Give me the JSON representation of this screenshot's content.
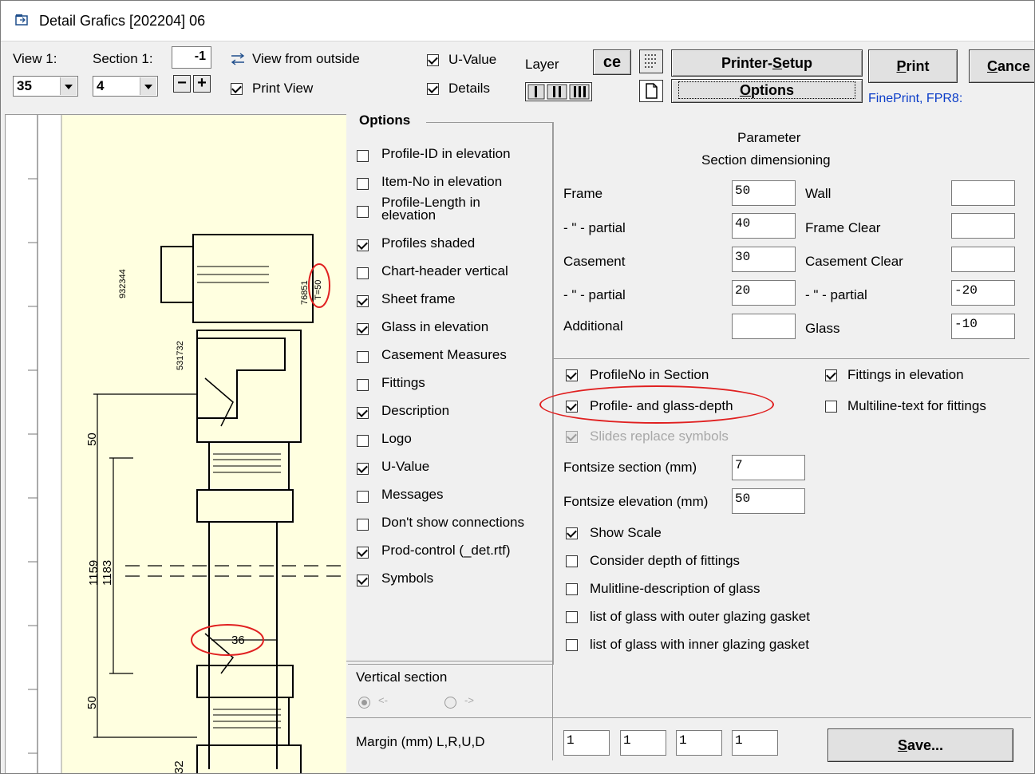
{
  "window": {
    "title": "Detail Grafics [202204] 06"
  },
  "toolbar": {
    "view_label": "View 1:",
    "view_value": "35",
    "section_label": "Section 1:",
    "section_value": "4",
    "section_offset": "-1",
    "view_from_outside": "View from outside",
    "print_view": "Print View",
    "u_value": "U-Value",
    "details": "Details",
    "layer": "Layer",
    "ce": "ce",
    "printer_setup": "Printer-Setup",
    "options": "Options",
    "print": "Print",
    "cancel": "Cance",
    "printer_name": "FinePrint, FPR8:"
  },
  "options": {
    "title": "Options",
    "items": [
      {
        "label": "Profile-ID in elevation",
        "checked": false
      },
      {
        "label": "Item-No in elevation",
        "checked": false
      },
      {
        "label": "Profile-Length in elevation",
        "checked": false
      },
      {
        "label": "Profiles shaded",
        "checked": true
      },
      {
        "label": "Chart-header vertical",
        "checked": false
      },
      {
        "label": "Sheet frame",
        "checked": true
      },
      {
        "label": "Glass in elevation",
        "checked": true
      },
      {
        "label": "Casement Measures",
        "checked": false
      },
      {
        "label": "Fittings",
        "checked": false
      },
      {
        "label": "Description",
        "checked": true
      },
      {
        "label": "Logo",
        "checked": false
      },
      {
        "label": "U-Value",
        "checked": true
      },
      {
        "label": "Messages",
        "checked": false
      },
      {
        "label": "Don't show connections",
        "checked": false
      },
      {
        "label": "Prod-control (_det.rtf)",
        "checked": true
      },
      {
        "label": "Symbols",
        "checked": true
      }
    ]
  },
  "parameter": {
    "title": "Parameter",
    "subtitle": "Section dimensioning",
    "frame": "Frame",
    "frame_val": "50",
    "frame_partial": "- \" - partial",
    "frame_partial_val": "40",
    "casement": "Casement",
    "casement_val": "30",
    "casement_partial": "- \" - partial",
    "casement_partial_val": "20",
    "additional": "Additional",
    "additional_val": "",
    "wall": "Wall",
    "wall_val": "",
    "frame_clear": "Frame Clear",
    "frame_clear_val": "",
    "casement_clear": "Casement Clear",
    "casement_clear_val": "",
    "clear_partial": "- \" - partial",
    "clear_partial_val": "-20",
    "glass": "Glass",
    "glass_val": "-10"
  },
  "section_opts": {
    "profileno": "ProfileNo in Section",
    "profile_glass_depth": "Profile- and glass-depth",
    "slides_replace": "Slides replace symbols",
    "fittings_elev": "Fittings in elevation",
    "multiline_fittings": "Multiline-text for fittings",
    "fontsize_section": "Fontsize section (mm)",
    "fontsize_section_val": "7",
    "fontsize_elevation": "Fontsize elevation (mm)",
    "fontsize_elevation_val": "50",
    "show_scale": "Show Scale",
    "consider_depth": "Consider depth of fittings",
    "multiline_glass": "Mulitline-description of glass",
    "outer_gasket": "list of glass with outer glazing gasket",
    "inner_gasket": "list of glass with inner glazing gasket"
  },
  "vertical_section": {
    "label": "Vertical section",
    "left": "<-",
    "right": "->"
  },
  "margin": {
    "label": "Margin (mm) L,R,U,D",
    "l": "1",
    "r": "1",
    "u": "1",
    "d": "1"
  },
  "save_label": "Save...",
  "drawing": {
    "code1": "932344",
    "code2": "531732",
    "code3": "76851",
    "t_label": "T=50",
    "dim50a": "50",
    "dim1159": "1159",
    "dim1183": "1183",
    "dim36": "36",
    "dim50b": "50",
    "code4": "32"
  }
}
